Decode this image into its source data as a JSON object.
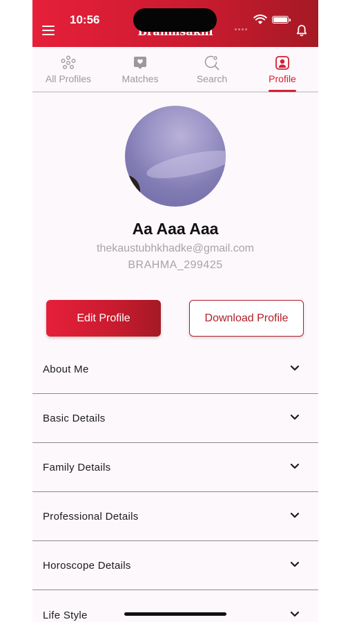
{
  "status_bar": {
    "time": "10:56"
  },
  "header": {
    "app_title": "Brahmsakhi",
    "menu_icon": "menu-icon",
    "bell_icon": "bell-icon"
  },
  "tabs": [
    {
      "label": "All Profiles",
      "icon": "all-profiles-icon",
      "active": false
    },
    {
      "label": "Matches",
      "icon": "matches-icon",
      "active": false
    },
    {
      "label": "Search",
      "icon": "search-icon",
      "active": false
    },
    {
      "label": "Profile",
      "icon": "profile-icon",
      "active": true
    }
  ],
  "profile": {
    "name": "Aa Aaa Aaa",
    "email": "thekaustubhkhadke@gmail.com",
    "id": "BRAHMA_299425"
  },
  "buttons": {
    "edit_profile": "Edit Profile",
    "download_profile": "Download Profile"
  },
  "sections": [
    {
      "label": "About Me"
    },
    {
      "label": "Basic Details"
    },
    {
      "label": "Family Details"
    },
    {
      "label": "Professional Details"
    },
    {
      "label": "Horoscope Details"
    },
    {
      "label": "Life Style"
    }
  ],
  "colors": {
    "brand": "#d41f33",
    "brand_dark": "#a51a24",
    "inactive": "#9a9a9a"
  }
}
